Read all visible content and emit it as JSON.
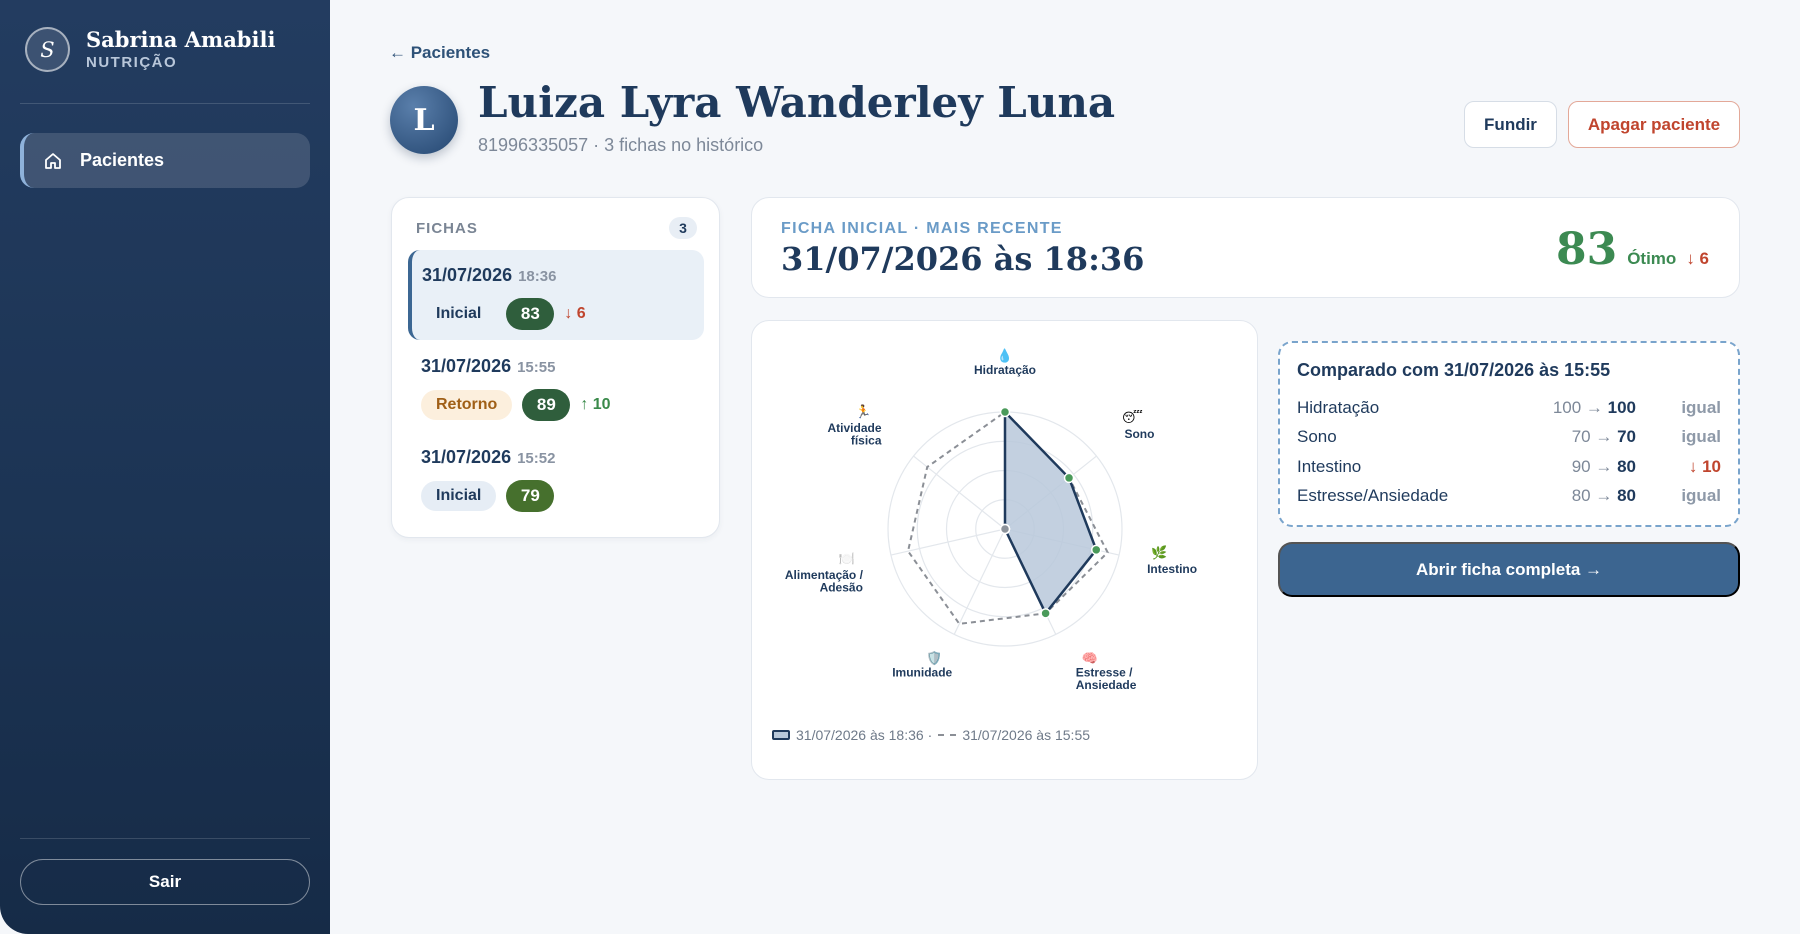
{
  "brand": {
    "logo_letter": "S",
    "name": "Sabrina Amabili",
    "subtitle": "NUTRIÇÃO"
  },
  "sidebar": {
    "items": [
      {
        "label": "Pacientes",
        "icon": "home-icon",
        "active": true
      }
    ],
    "logout_label": "Sair"
  },
  "nav": {
    "back_label": "← Pacientes"
  },
  "patient": {
    "avatar_letter": "L",
    "name": "Luiza Lyra Wanderley Luna",
    "meta": "81996335057 · 3 fichas no histórico"
  },
  "actions": {
    "merge_label": "Fundir",
    "delete_label": "Apagar paciente"
  },
  "fichas": {
    "title": "FICHAS",
    "count": "3",
    "items": [
      {
        "date": "31/07/2026",
        "time": "18:36",
        "type": "Inicial",
        "score": "83",
        "delta": "↓ 6",
        "delta_dir": "down",
        "active": true
      },
      {
        "date": "31/07/2026",
        "time": "15:55",
        "type": "Retorno",
        "score": "89",
        "delta": "↑ 10",
        "delta_dir": "up",
        "active": false
      },
      {
        "date": "31/07/2026",
        "time": "15:52",
        "type": "Inicial",
        "score": "79",
        "delta": "",
        "delta_dir": "",
        "active": false
      }
    ]
  },
  "current": {
    "label": "FICHA INICIAL · MAIS RECENTE",
    "date": "31/07/2026 às 18:36",
    "score": "83",
    "score_label": "Ótimo",
    "score_delta": "↓ 6",
    "score_color": "#3c8a52"
  },
  "chart_data": {
    "type": "radar",
    "axes": [
      {
        "label": "Hidratação",
        "icon": "💧"
      },
      {
        "label": "Sono",
        "icon": "😴"
      },
      {
        "label": "Intestino",
        "icon": "🌿"
      },
      {
        "label": "Estresse / Ansiedade",
        "icon": "🧠"
      },
      {
        "label": "Imunidade",
        "icon": "🛡️"
      },
      {
        "label": "Alimentação / Adesão",
        "icon": "🍽️"
      },
      {
        "label": "Atividade física",
        "icon": "🏃"
      }
    ],
    "range": [
      0,
      100
    ],
    "series": [
      {
        "name": "31/07/2026 às 18:36",
        "values": [
          100,
          70,
          80,
          80,
          0,
          0,
          0
        ],
        "style": "filled",
        "color": "#1f3a5c",
        "fill": "#b8c8da"
      },
      {
        "name": "31/07/2026 às 15:55",
        "values": [
          100,
          70,
          90,
          80,
          90,
          85,
          85
        ],
        "style": "dashed",
        "color": "#8b8f96"
      }
    ],
    "legend_separator": "·"
  },
  "compare": {
    "title": "Comparado com 31/07/2026 às 15:55",
    "rows": [
      {
        "label": "Hidratação",
        "old": "100",
        "new": "100",
        "status": "igual",
        "dir": "same"
      },
      {
        "label": "Sono",
        "old": "70",
        "new": "70",
        "status": "igual",
        "dir": "same"
      },
      {
        "label": "Intestino",
        "old": "90",
        "new": "80",
        "status": "↓ 10",
        "dir": "down"
      },
      {
        "label": "Estresse/Ansiedade",
        "old": "80",
        "new": "80",
        "status": "igual",
        "dir": "same"
      }
    ],
    "arrow": "→"
  },
  "open_button_label": "Abrir ficha completa →"
}
